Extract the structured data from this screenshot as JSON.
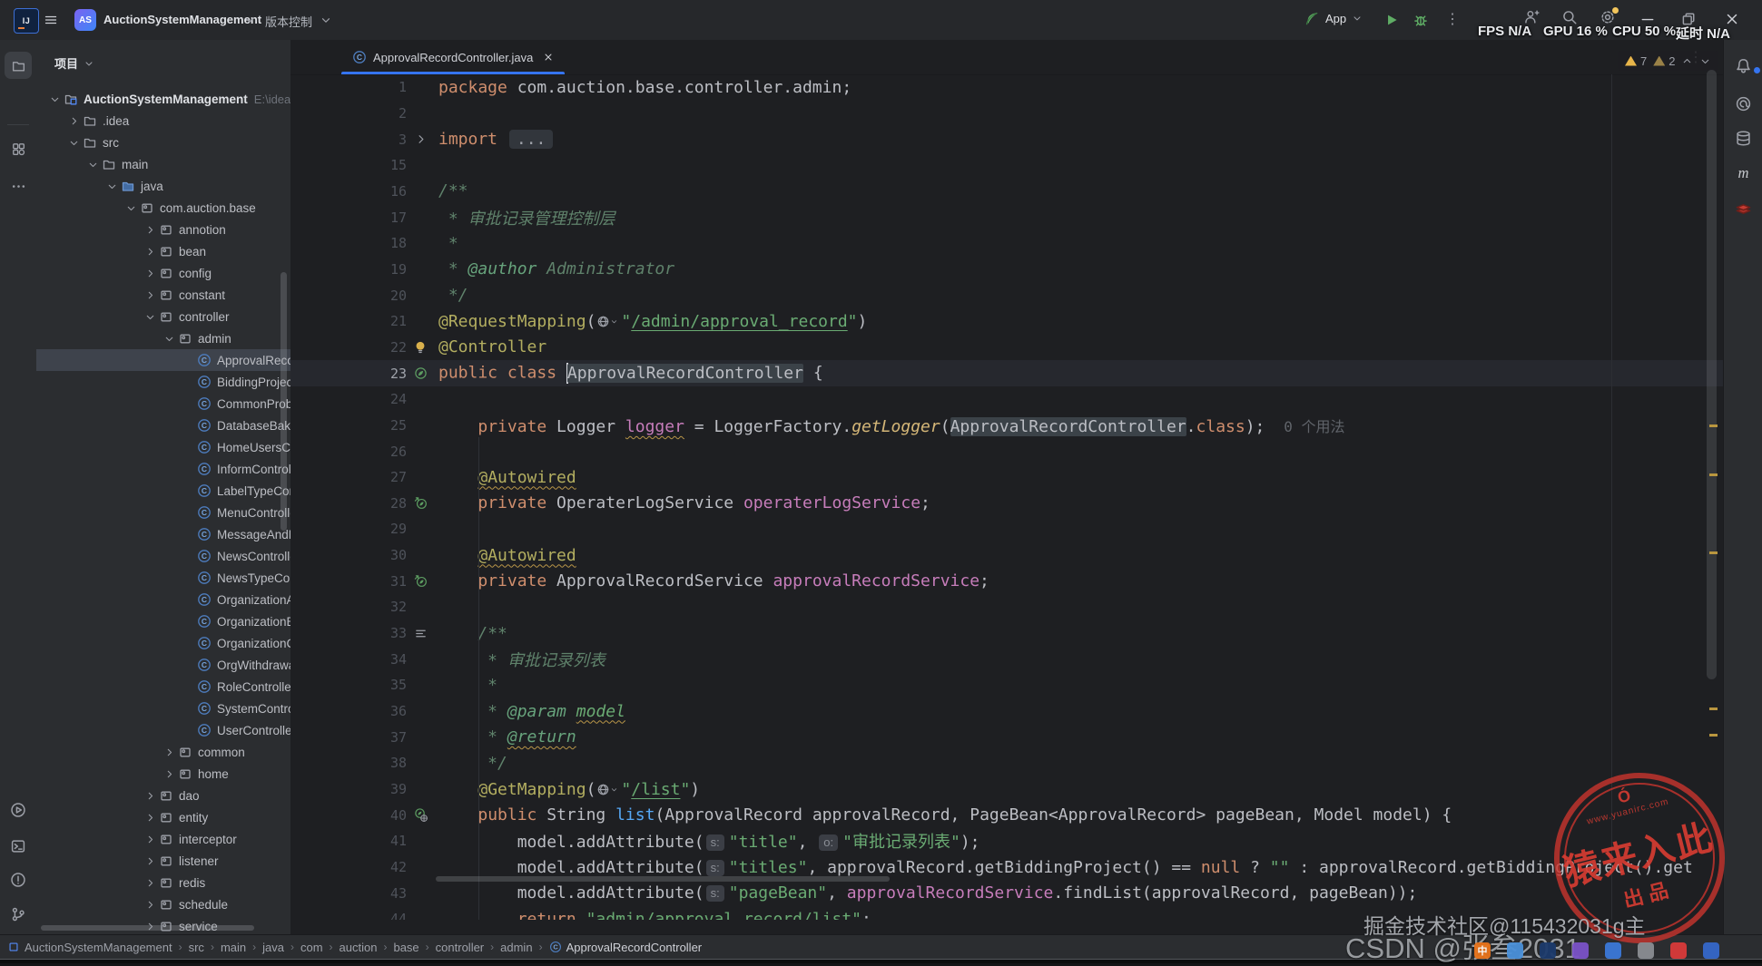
{
  "titlebar": {
    "app_icon": "intellij-idea",
    "project_badge": "AS",
    "project_name": "AuctionSystemManagement",
    "vcs_label": "版本控制",
    "run_config_label": "App",
    "perf": [
      {
        "label": "FPS",
        "value": "N/A"
      },
      {
        "label": "GPU",
        "value": "16 %"
      },
      {
        "label": "CPU",
        "value": "50 %"
      },
      {
        "label": "延时",
        "value": "N/A"
      }
    ]
  },
  "colors": {
    "accent_blue": "#3574f0",
    "run_green": "#5fad65",
    "warning_yellow": "#f2c55c",
    "stamp_red": "#c9352e"
  },
  "left_strip": {
    "top": [
      {
        "icon": "folder",
        "name": "project-tool",
        "active": true
      },
      {
        "icon": "modules",
        "name": "structure-tool",
        "active": false
      },
      {
        "icon": "moreH",
        "name": "more-tools",
        "active": false
      }
    ],
    "bottom": [
      {
        "icon": "runPlay",
        "name": "run-tool"
      },
      {
        "icon": "term",
        "name": "terminal-tool"
      },
      {
        "icon": "probl",
        "name": "problems-tool"
      },
      {
        "icon": "git",
        "name": "version-control-tool"
      }
    ]
  },
  "right_strip": [
    {
      "icon": "bell",
      "name": "notifications",
      "badge": true
    },
    {
      "icon": "ai",
      "name": "ai-assistant"
    },
    {
      "icon": "db",
      "name": "database-tool"
    },
    {
      "icon": "maven",
      "name": "maven-tool"
    },
    {
      "icon": "redis",
      "name": "redis-plugin"
    }
  ],
  "project_panel": {
    "header": "项目",
    "tree": [
      {
        "l": 0,
        "c": "down",
        "i": "proj",
        "label": "AuctionSystemManagement",
        "bold": true,
        "path": "E:\\idea_space\\Auc"
      },
      {
        "l": 1,
        "c": "right",
        "i": "folder",
        "label": ".idea"
      },
      {
        "l": 1,
        "c": "down",
        "i": "folder",
        "label": "src"
      },
      {
        "l": 2,
        "c": "down",
        "i": "folder",
        "label": "main"
      },
      {
        "l": 3,
        "c": "down",
        "i": "folderJ",
        "label": "java"
      },
      {
        "l": 4,
        "c": "down",
        "i": "pkg",
        "label": "com.auction.base"
      },
      {
        "l": 5,
        "c": "right",
        "i": "pkg",
        "label": "annotion"
      },
      {
        "l": 5,
        "c": "right",
        "i": "pkg",
        "label": "bean"
      },
      {
        "l": 5,
        "c": "right",
        "i": "pkg",
        "label": "config"
      },
      {
        "l": 5,
        "c": "right",
        "i": "pkg",
        "label": "constant"
      },
      {
        "l": 5,
        "c": "down",
        "i": "pkg",
        "label": "controller"
      },
      {
        "l": 6,
        "c": "down",
        "i": "pkg",
        "label": "admin"
      },
      {
        "l": 7,
        "i": "cls",
        "label": "ApprovalRecordController",
        "selected": true
      },
      {
        "l": 7,
        "i": "cls",
        "label": "BiddingProjectController"
      },
      {
        "l": 7,
        "i": "cls",
        "label": "CommonProblemController"
      },
      {
        "l": 7,
        "i": "cls",
        "label": "DatabaseBakController"
      },
      {
        "l": 7,
        "i": "cls",
        "label": "HomeUsersController"
      },
      {
        "l": 7,
        "i": "cls",
        "label": "InformController"
      },
      {
        "l": 7,
        "i": "cls",
        "label": "LabelTypeController"
      },
      {
        "l": 7,
        "i": "cls",
        "label": "MenuController"
      },
      {
        "l": 7,
        "i": "cls",
        "label": "MessageAndReplyController"
      },
      {
        "l": 7,
        "i": "cls",
        "label": "NewsController"
      },
      {
        "l": 7,
        "i": "cls",
        "label": "NewsTypeController"
      },
      {
        "l": 7,
        "i": "cls",
        "label": "OrganizationAlipayController"
      },
      {
        "l": 7,
        "i": "cls",
        "label": "OrganizationBankCardController"
      },
      {
        "l": 7,
        "i": "cls",
        "label": "OrganizationController"
      },
      {
        "l": 7,
        "i": "cls",
        "label": "OrgWithdrawalRecordController"
      },
      {
        "l": 7,
        "i": "cls",
        "label": "RoleController"
      },
      {
        "l": 7,
        "i": "cls",
        "label": "SystemController"
      },
      {
        "l": 7,
        "i": "cls",
        "label": "UserController"
      },
      {
        "l": 6,
        "c": "right",
        "i": "pkg",
        "label": "common"
      },
      {
        "l": 6,
        "c": "right",
        "i": "pkg",
        "label": "home"
      },
      {
        "l": 5,
        "c": "right",
        "i": "pkg",
        "label": "dao"
      },
      {
        "l": 5,
        "c": "right",
        "i": "pkg",
        "label": "entity"
      },
      {
        "l": 5,
        "c": "right",
        "i": "pkg",
        "label": "interceptor"
      },
      {
        "l": 5,
        "c": "right",
        "i": "pkg",
        "label": "listener"
      },
      {
        "l": 5,
        "c": "right",
        "i": "pkg",
        "label": "redis"
      },
      {
        "l": 5,
        "c": "right",
        "i": "pkg",
        "label": "schedule"
      },
      {
        "l": 5,
        "c": "right",
        "i": "pkg",
        "label": "service"
      }
    ]
  },
  "editor": {
    "tab": {
      "label": "ApprovalRecordController.java",
      "icon": "cls"
    },
    "inspections": {
      "warnings_strong": "7",
      "warnings_weak": "2"
    },
    "lines": [
      {
        "n": "1",
        "t": [
          [
            "kw",
            "package"
          ],
          [
            "def",
            " com.auction.base.controller.admin;"
          ]
        ]
      },
      {
        "n": "2",
        "t": []
      },
      {
        "n": "3",
        "g": "foldR",
        "t": [
          [
            "kw",
            "import"
          ],
          [
            "def",
            " "
          ],
          [
            "fold",
            "..."
          ]
        ]
      },
      {
        "n": "15",
        "t": []
      },
      {
        "n": "16",
        "t": [
          [
            "doc",
            "/**"
          ]
        ]
      },
      {
        "n": "17",
        "t": [
          [
            "doc",
            " * 审批记录管理控制层"
          ]
        ]
      },
      {
        "n": "18",
        "t": [
          [
            "doc",
            " *"
          ]
        ]
      },
      {
        "n": "19",
        "t": [
          [
            "doc",
            " * "
          ],
          [
            "doctag",
            "@author"
          ],
          [
            "doc",
            " Administrator"
          ]
        ]
      },
      {
        "n": "20",
        "t": [
          [
            "doc",
            " */"
          ]
        ]
      },
      {
        "n": "21",
        "t": [
          [
            "ann",
            "@RequestMapping"
          ],
          [
            "def",
            "("
          ],
          [
            "globe",
            ""
          ],
          [
            "str",
            "\""
          ],
          [
            "strl",
            "/admin/approval_record"
          ],
          [
            "str",
            "\""
          ],
          [
            "def",
            ")"
          ]
        ]
      },
      {
        "n": "22",
        "g": "bulb",
        "t": [
          [
            "ann",
            "@Controller"
          ]
        ]
      },
      {
        "n": "23",
        "g": "bean",
        "cur": true,
        "t": [
          [
            "kw",
            "public class "
          ],
          [
            "caret",
            ""
          ],
          [
            "hl",
            "ApprovalRecordController"
          ],
          [
            "def",
            " {"
          ]
        ]
      },
      {
        "n": "24",
        "t": []
      },
      {
        "n": "25",
        "t": [
          [
            "def",
            "    "
          ],
          [
            "kw",
            "private"
          ],
          [
            "def",
            " Logger "
          ],
          [
            "fieldw",
            "logger"
          ],
          [
            "def",
            " = LoggerFactory."
          ],
          [
            "sm",
            "getLogger"
          ],
          [
            "def",
            "("
          ],
          [
            "hl",
            "ApprovalRecordController"
          ],
          [
            "def",
            "."
          ],
          [
            "kw",
            "class"
          ],
          [
            "def",
            "); "
          ],
          [
            "inlay",
            "0 个用法"
          ]
        ]
      },
      {
        "n": "26",
        "t": []
      },
      {
        "n": "27",
        "t": [
          [
            "def",
            "    "
          ],
          [
            "annw",
            "@Autowired"
          ]
        ]
      },
      {
        "n": "28",
        "g": "beanA",
        "t": [
          [
            "def",
            "    "
          ],
          [
            "kw",
            "private"
          ],
          [
            "def",
            " OperaterLogService "
          ],
          [
            "field",
            "operaterLogService"
          ],
          [
            "def",
            ";"
          ]
        ]
      },
      {
        "n": "29",
        "t": []
      },
      {
        "n": "30",
        "t": [
          [
            "def",
            "    "
          ],
          [
            "annw",
            "@Autowired"
          ]
        ]
      },
      {
        "n": "31",
        "g": "beanA",
        "t": [
          [
            "def",
            "    "
          ],
          [
            "kw",
            "private"
          ],
          [
            "def",
            " ApprovalRecordService "
          ],
          [
            "field",
            "approvalRecordService"
          ],
          [
            "def",
            ";"
          ]
        ]
      },
      {
        "n": "32",
        "t": []
      },
      {
        "n": "33",
        "g": "lines3",
        "t": [
          [
            "def",
            "    "
          ],
          [
            "doc",
            "/**"
          ]
        ]
      },
      {
        "n": "34",
        "t": [
          [
            "doc",
            "     * 审批记录列表"
          ]
        ]
      },
      {
        "n": "35",
        "t": [
          [
            "doc",
            "     *"
          ]
        ]
      },
      {
        "n": "36",
        "t": [
          [
            "doc",
            "     * "
          ],
          [
            "doctag",
            "@param"
          ],
          [
            "doc",
            " "
          ],
          [
            "docpw",
            "model"
          ]
        ]
      },
      {
        "n": "37",
        "t": [
          [
            "doc",
            "     * "
          ],
          [
            "doctagw",
            "@return"
          ]
        ]
      },
      {
        "n": "38",
        "t": [
          [
            "doc",
            "     */"
          ]
        ]
      },
      {
        "n": "39",
        "t": [
          [
            "def",
            "    "
          ],
          [
            "ann",
            "@GetMapping"
          ],
          [
            "def",
            "("
          ],
          [
            "globe",
            ""
          ],
          [
            "str",
            "\""
          ],
          [
            "strl",
            "/list"
          ],
          [
            "str",
            "\""
          ],
          [
            "def",
            ")"
          ]
        ]
      },
      {
        "n": "40",
        "g": "beanG",
        "t": [
          [
            "def",
            "    "
          ],
          [
            "kw",
            "public"
          ],
          [
            "def",
            " String "
          ],
          [
            "m",
            "list"
          ],
          [
            "def",
            "(ApprovalRecord approvalRecord, PageBean<ApprovalRecord> pageBean, Model model) {"
          ]
        ]
      },
      {
        "n": "41",
        "t": [
          [
            "def",
            "        model.addAttribute("
          ],
          [
            "chip",
            "s:"
          ],
          [
            "str",
            "\"title\""
          ],
          [
            "def",
            ", "
          ],
          [
            "chip",
            "o:"
          ],
          [
            "str",
            "\"审批记录列表\""
          ],
          [
            "def",
            ");"
          ]
        ]
      },
      {
        "n": "42",
        "t": [
          [
            "def",
            "        model.addAttribute("
          ],
          [
            "chip",
            "s:"
          ],
          [
            "str",
            "\"titles\""
          ],
          [
            "def",
            ", approvalRecord.getBiddingProject() == "
          ],
          [
            "kw",
            "null"
          ],
          [
            "def",
            " ? "
          ],
          [
            "str",
            "\"\""
          ],
          [
            "def",
            " : approvalRecord.getBiddingProject().get"
          ]
        ]
      },
      {
        "n": "43",
        "t": [
          [
            "def",
            "        model.addAttribute("
          ],
          [
            "chip",
            "s:"
          ],
          [
            "str",
            "\"pageBean\""
          ],
          [
            "def",
            ", "
          ],
          [
            "field",
            "approvalRecordService"
          ],
          [
            "def",
            ".findList(approvalRecord, pageBean));"
          ]
        ]
      },
      {
        "n": "44",
        "t": [
          [
            "def",
            "        "
          ],
          [
            "kw",
            "return"
          ],
          [
            "def",
            " "
          ],
          [
            "str",
            "\"admin/approval_record/list\""
          ],
          [
            "def",
            ";"
          ]
        ]
      }
    ]
  },
  "breadcrumbs": [
    {
      "icon": "blueSq",
      "label": "AuctionSystemManagement"
    },
    {
      "label": "src"
    },
    {
      "label": "main"
    },
    {
      "label": "java"
    },
    {
      "label": "com"
    },
    {
      "label": "auction"
    },
    {
      "label": "base"
    },
    {
      "label": "controller"
    },
    {
      "label": "admin"
    },
    {
      "icon": "cls",
      "label": "ApprovalRecordController",
      "last": true
    }
  ],
  "watermarks": {
    "stamp": {
      "line1": "猿来入此",
      "line2": "出品",
      "url": "www.yuanirc.com",
      "logo": "Ó"
    },
    "juejin": "掘金技术社区@115432031g主",
    "csdn": "CSDN @张叁2031",
    "taskbar_icons": [
      {
        "color": "#e8731a",
        "text": "中"
      },
      {
        "color": "#4a90d9",
        "text": ""
      },
      {
        "color": "#1b3a6b",
        "text": ""
      },
      {
        "color": "#7a52c7",
        "text": ""
      },
      {
        "color": "#3b78d8",
        "text": ""
      },
      {
        "color": "#8a8d92",
        "text": ""
      },
      {
        "color": "#d93a3a",
        "text": ""
      },
      {
        "color": "#3567c9",
        "text": ""
      }
    ]
  }
}
